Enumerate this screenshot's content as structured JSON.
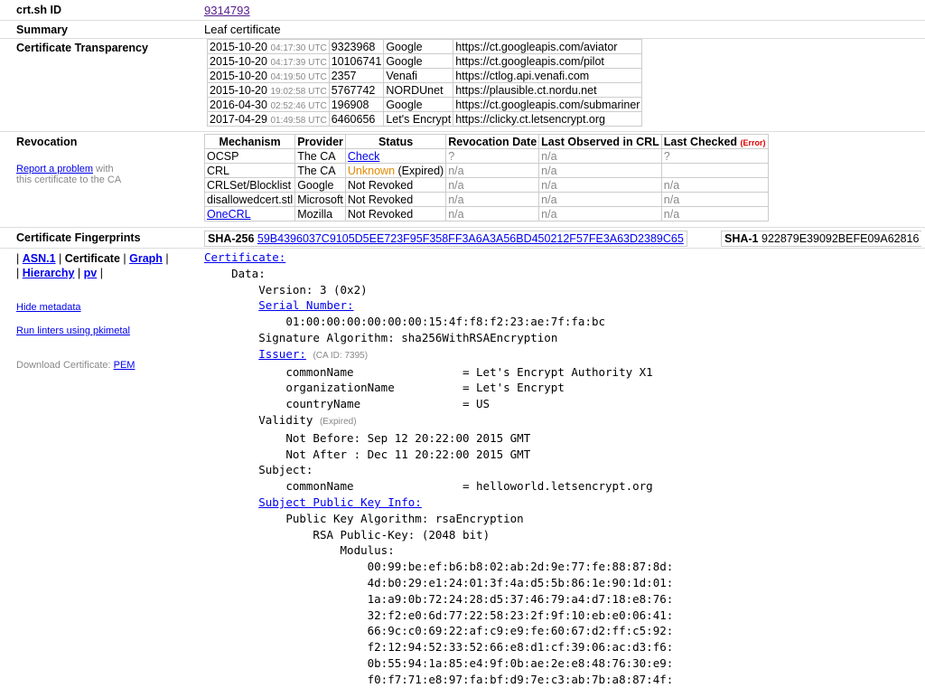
{
  "crtsh_id": {
    "label": "crt.sh ID",
    "value": "9314793"
  },
  "summary": {
    "label": "Summary",
    "value": "Leaf certificate"
  },
  "ct": {
    "label": "Certificate Transparency",
    "rows": [
      {
        "date": "2015-10-20",
        "time": "04:17:30 UTC",
        "entry": "9323968",
        "operator": "Google",
        "url": "https://ct.googleapis.com/aviator"
      },
      {
        "date": "2015-10-20",
        "time": "04:17:39 UTC",
        "entry": "10106741",
        "operator": "Google",
        "url": "https://ct.googleapis.com/pilot"
      },
      {
        "date": "2015-10-20",
        "time": "04:19:50 UTC",
        "entry": "2357",
        "operator": "Venafi",
        "url": "https://ctlog.api.venafi.com"
      },
      {
        "date": "2015-10-20",
        "time": "19:02:58 UTC",
        "entry": "5767742",
        "operator": "NORDUnet",
        "url": "https://plausible.ct.nordu.net"
      },
      {
        "date": "2016-04-30",
        "time": "02:52:46 UTC",
        "entry": "196908",
        "operator": "Google",
        "url": "https://ct.googleapis.com/submariner"
      },
      {
        "date": "2017-04-29",
        "time": "01:49:58 UTC",
        "entry": "6460656",
        "operator": "Let's Encrypt",
        "url": "https://clicky.ct.letsencrypt.org"
      }
    ]
  },
  "revocation": {
    "label": "Revocation",
    "report_link": "Report a problem",
    "report_text1": " with",
    "report_text2": "this certificate to the CA",
    "headers": {
      "mechanism": "Mechanism",
      "provider": "Provider",
      "status": "Status",
      "rev_date": "Revocation Date",
      "last_observed": "Last Observed in CRL",
      "last_checked": "Last Checked",
      "error": "(Error)"
    },
    "rows": {
      "ocsp": {
        "mechanism": "OCSP",
        "provider": "The CA",
        "status": "Check",
        "rev_date": "?",
        "last_observed": "n/a",
        "last_checked": "?"
      },
      "crl": {
        "mechanism": "CRL",
        "provider": "The CA",
        "status": "Unknown",
        "status_extra": " (Expired)",
        "rev_date": "n/a",
        "last_observed": "n/a",
        "last_checked": ""
      },
      "crlset": {
        "mechanism": "CRLSet/Blocklist",
        "provider": "Google",
        "status": "Not Revoked",
        "rev_date": "n/a",
        "last_observed": "n/a",
        "last_checked": "n/a"
      },
      "disallowed": {
        "mechanism": "disallowedcert.stl",
        "provider": "Microsoft",
        "status": "Not Revoked",
        "rev_date": "n/a",
        "last_observed": "n/a",
        "last_checked": "n/a"
      },
      "onecrl": {
        "mechanism": "OneCRL",
        "provider": "Mozilla",
        "status": "Not Revoked",
        "rev_date": "n/a",
        "last_observed": "n/a",
        "last_checked": "n/a"
      }
    }
  },
  "fingerprints": {
    "label": "Certificate Fingerprints",
    "sha256_label": "SHA-256",
    "sha256": "59B4396037C9105D5EE723F95F358FF3A6A3A56BD450212F57FE3A63D2389C65",
    "sha1_label": "SHA-1",
    "sha1": "922879E39092BEFE09A62816"
  },
  "views": {
    "bar1": "| ",
    "asn1": "ASN.1",
    "bar2": " | ",
    "certificate": "Certificate",
    "bar3": " | ",
    "graph": "Graph",
    "bar4": " |",
    "bar5": "| ",
    "hierarchy": "Hierarchy",
    "bar6": " | ",
    "pv": "pv",
    "bar7": " |"
  },
  "side": {
    "hide_metadata": "Hide metadata",
    "run_linters": "Run linters using pkimetal",
    "download_label": "Download Certificate: ",
    "pem": "PEM"
  },
  "cert": {
    "certificate": "Certificate:",
    "data": "Data:",
    "version": "Version: 3 (0x2)",
    "serial_label": "Serial Number:",
    "serial": "01:00:00:00:00:00:00:15:4f:f8:f2:23:ae:7f:fa:bc",
    "sigalg": "Signature Algorithm: sha256WithRSAEncryption",
    "issuer_label": "Issuer:",
    "issuer_caid": "(CA ID: 7395)",
    "issuer_cn": "commonName                = Let's Encrypt Authority X1",
    "issuer_o": "organizationName          = Let's Encrypt",
    "issuer_c": "countryName               = US",
    "validity": "Validity",
    "expired": "(Expired)",
    "not_before": "Not Before: Sep 12 20:22:00 2015 GMT",
    "not_after": "Not After : Dec 11 20:22:00 2015 GMT",
    "subject": "Subject:",
    "subject_cn": "commonName                = helloworld.letsencrypt.org",
    "spki_label": "Subject Public Key Info:",
    "pk_alg": "Public Key Algorithm: rsaEncryption",
    "rsa_pk": "RSA Public-Key: (2048 bit)",
    "modulus": "Modulus:",
    "mod1": "00:99:be:ef:b6:b8:02:ab:2d:9e:77:fe:88:87:8d:",
    "mod2": "4d:b0:29:e1:24:01:3f:4a:d5:5b:86:1e:90:1d:01:",
    "mod3": "1a:a9:0b:72:24:28:d5:37:46:79:a4:d7:18:e8:76:",
    "mod4": "32:f2:e0:6d:77:22:58:23:2f:9f:10:eb:e0:06:41:",
    "mod5": "66:9c:c0:69:22:af:c9:e9:fe:60:67:d2:ff:c5:92:",
    "mod6": "f2:12:94:52:33:52:66:e8:d1:cf:39:06:ac:d3:f6:",
    "mod7": "0b:55:94:1a:85:e4:9f:0b:ae:2e:e8:48:76:30:e9:",
    "mod8": "f0:f7:71:e8:97:fa:bf:d9:7e:c3:ab:7b:a8:87:4f:"
  }
}
